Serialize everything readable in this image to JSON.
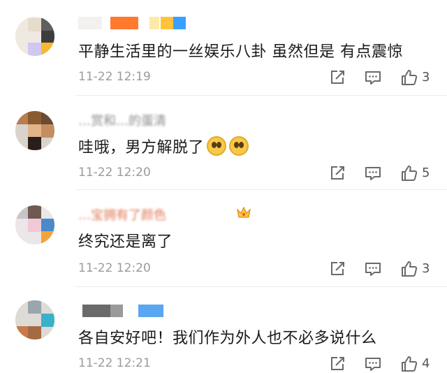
{
  "comments": [
    {
      "text": "平静生活里的一丝娱乐八卦 虽然但是 有点震惊",
      "time": "11-22 12:19",
      "likes": "3",
      "nickname_visible": "",
      "emoji_count": 0,
      "colors": {
        "avatar": [
          "#e8e0d2",
          "#6a6a6a",
          "#3d3d3d",
          "#d4cfee",
          "#c9b9e8",
          "#f5b932"
        ],
        "nick": [
          "#ff7a2e",
          "#ffd43a",
          "#3aa0ff"
        ]
      }
    },
    {
      "text": "哇哦，男方解脱了",
      "time": "11-22 12:20",
      "likes": "5",
      "nickname_visible": "…赏和…的蛋清",
      "emoji_count": 2,
      "emoji_name": "hug-face-emoji",
      "colors": {
        "avatar": [
          "#c98c5a",
          "#8c5a32",
          "#3a2a1e",
          "#e1b48a",
          "#2a1f18",
          "#d7d1cc"
        ]
      }
    },
    {
      "text": "终究还是离了",
      "time": "11-22 12:20",
      "likes": "3",
      "nickname_visible": "…宝拥有了颜色",
      "emoji_count": 0,
      "badge": "crown-icon",
      "colors": {
        "avatar": [
          "#c9c4c7",
          "#f0c8d8",
          "#7a5a4c",
          "#4a8ac8",
          "#ebe6e8",
          "#f4a23c"
        ]
      }
    },
    {
      "text": "各自安好吧！我们作为外人也不必多说什么",
      "time": "11-22 12:21",
      "likes": "4",
      "nickname_visible": "",
      "emoji_count": 0,
      "colors": {
        "avatar": [
          "#d8d8d8",
          "#9aa6ad",
          "#3ab1c8",
          "#c97a4a",
          "#d9d6d2",
          "#b9b4ae"
        ],
        "nick": [
          "#6a6a6a",
          "#5aa6f0"
        ]
      }
    }
  ],
  "icons": {
    "share": "share-icon",
    "reply": "comment-icon",
    "like": "thumbs-up-icon"
  }
}
